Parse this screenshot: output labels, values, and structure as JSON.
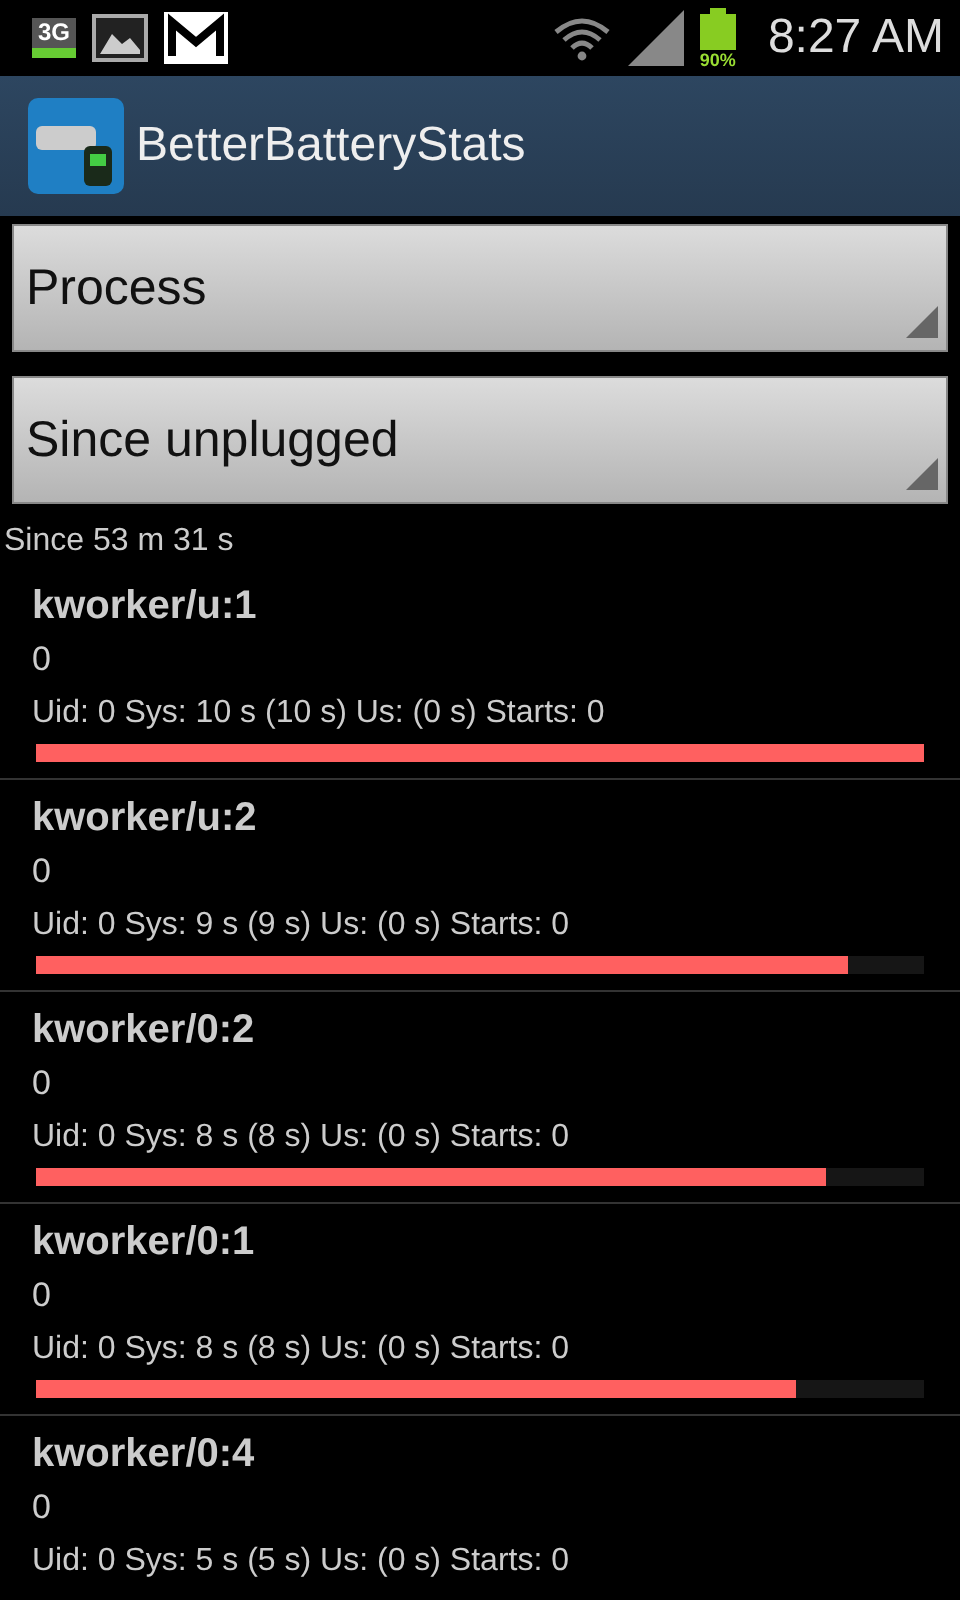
{
  "status_bar": {
    "network": "3G",
    "battery": "90%",
    "time": "8:27 AM"
  },
  "action_bar": {
    "title": "BetterBatteryStats"
  },
  "spinners": [
    {
      "value": "Process"
    },
    {
      "value": "Since unplugged"
    }
  ],
  "since": "Since 53 m 31 s",
  "processes": [
    {
      "name": "kworker/u:1",
      "value": "0",
      "details": "Uid: 0 Sys: 10 s  (10 s) Us:  (0 s) Starts: 0",
      "level": 1.0
    },
    {
      "name": "kworker/u:2",
      "value": "0",
      "details": "Uid: 0 Sys: 9 s  (9 s) Us:  (0 s) Starts: 0",
      "level": 0.915
    },
    {
      "name": "kworker/0:2",
      "value": "0",
      "details": "Uid: 0 Sys: 8 s  (8 s) Us:  (0 s) Starts: 0",
      "level": 0.89
    },
    {
      "name": "kworker/0:1",
      "value": "0",
      "details": "Uid: 0 Sys: 8 s  (8 s) Us:  (0 s) Starts: 0",
      "level": 0.856
    },
    {
      "name": "kworker/0:4",
      "value": "0",
      "details": "Uid: 0 Sys: 5 s  (5 s) Us:  (0 s) Starts: 0"
    }
  ]
}
